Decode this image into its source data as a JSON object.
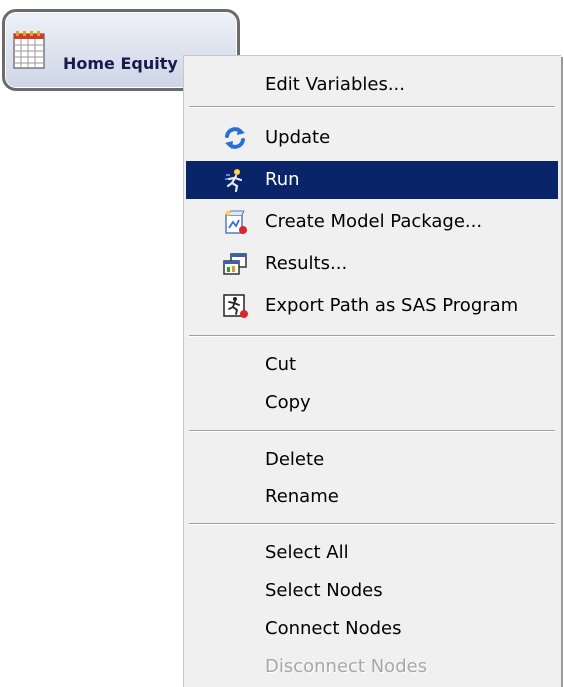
{
  "node": {
    "label": "Home Equity",
    "icon": "data-source-table-icon"
  },
  "menu": {
    "edit_variables": "Edit Variables...",
    "update": "Update",
    "run": "Run",
    "create_model_package": "Create Model Package...",
    "results": "Results...",
    "export_path": "Export Path as SAS Program",
    "cut": "Cut",
    "copy": "Copy",
    "delete": "Delete",
    "rename": "Rename",
    "select_all": "Select All",
    "select_nodes": "Select Nodes",
    "connect_nodes": "Connect Nodes",
    "disconnect_nodes": "Disconnect Nodes"
  },
  "icons": {
    "update": "refresh-icon",
    "run": "run-icon",
    "create_model_package": "model-package-icon",
    "results": "results-window-icon",
    "export_path": "export-program-icon"
  },
  "colors": {
    "selection": "#0a246a",
    "menu_background": "#f0f0f0",
    "disabled_text": "#a7a7a7",
    "node_border": "#6b6b6b"
  },
  "state": {
    "highlighted_item": "Run",
    "disabled_items": [
      "Disconnect Nodes"
    ]
  }
}
